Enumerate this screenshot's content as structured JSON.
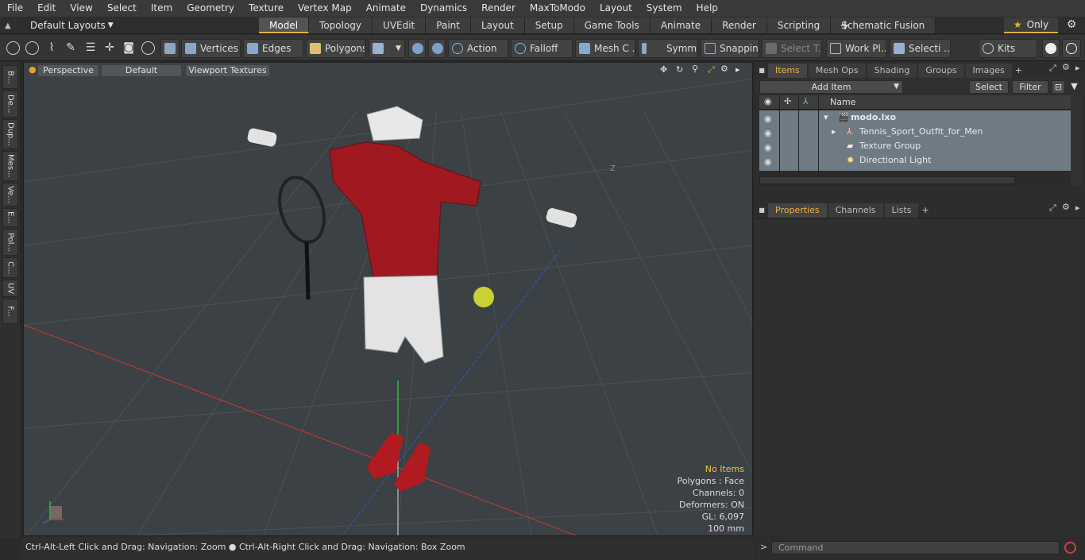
{
  "menu": [
    "File",
    "Edit",
    "View",
    "Select",
    "Item",
    "Geometry",
    "Texture",
    "Vertex Map",
    "Animate",
    "Dynamics",
    "Render",
    "MaxToModo",
    "Layout",
    "System",
    "Help"
  ],
  "layouts": "Default Layouts",
  "tabs": [
    "Model",
    "Topology",
    "UVEdit",
    "Paint",
    "Layout",
    "Setup",
    "Game Tools",
    "Animate",
    "Render",
    "Scripting",
    "Schematic Fusion"
  ],
  "active_tab": "Model",
  "only": "Only",
  "toolbar": {
    "vertices": "Vertices",
    "edges": "Edges",
    "polygons": "Polygons",
    "action": "Action",
    "falloff": "Falloff",
    "mesh": "Mesh C ...",
    "symm": "Symm ...",
    "snapping": "Snapping",
    "select_t": "Select T...",
    "workpl": "Work Pl...",
    "selecti": "Selecti ...",
    "kits": "Kits"
  },
  "left_tabs": [
    "B...",
    "De...",
    "Dup...",
    "Mes...",
    "Ve...",
    "E...",
    "Pol...",
    "C...",
    "UV",
    "F..."
  ],
  "viewport": {
    "perspective": "Perspective",
    "default": "Default",
    "textures": "Viewport Textures",
    "axis_z": "Z"
  },
  "stats": {
    "items": "No Items",
    "polygons": "Polygons : Face",
    "channels": "Channels: 0",
    "deformers": "Deformers: ON",
    "gl": "GL: 6,097",
    "scale": "100 mm"
  },
  "status": "Ctrl-Alt-Left Click and Drag: Navigation: Zoom ● Ctrl-Alt-Right Click and Drag: Navigation: Box Zoom",
  "panel_tabs": [
    "Items",
    "Mesh Ops",
    "Shading",
    "Groups",
    "Images"
  ],
  "add_item": "Add Item",
  "select_btn": "Select",
  "filter_btn": "Filter",
  "name_col": "Name",
  "tree": [
    "modo.lxo",
    "Tennis_Sport_Outfit_for_Men",
    "Texture Group",
    "Directional Light"
  ],
  "prop_tabs": [
    "Properties",
    "Channels",
    "Lists"
  ],
  "command": "Command"
}
